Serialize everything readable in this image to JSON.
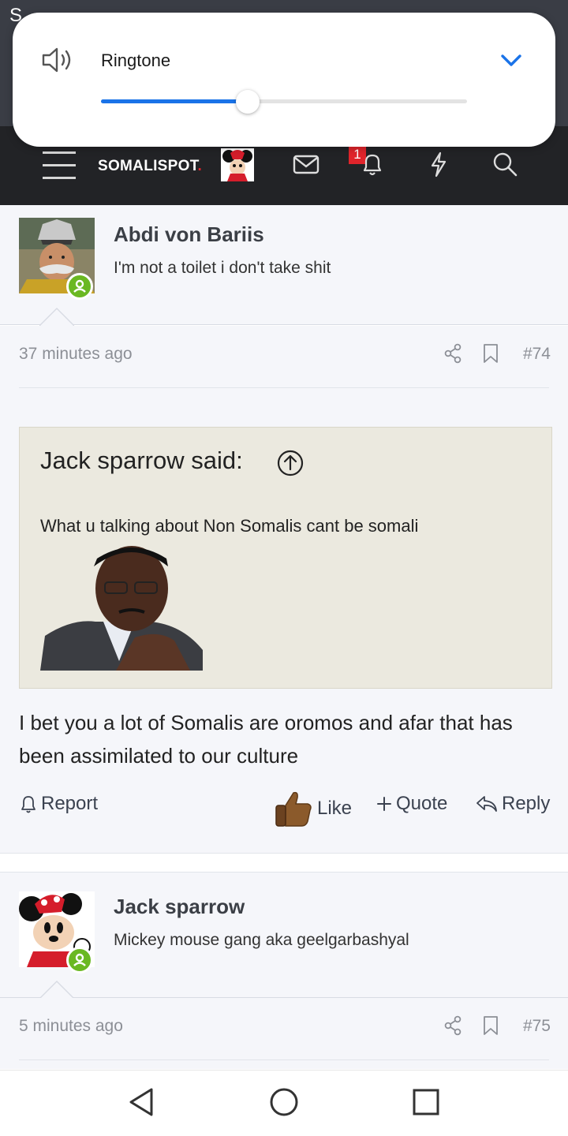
{
  "status_bar": {
    "left_text": "S",
    "right_text": ""
  },
  "volume_panel": {
    "title": "Ringtone",
    "level": 0.4
  },
  "nav": {
    "logo_text": "SOMALISPOT",
    "logo_dot": ".",
    "notification_count": "1"
  },
  "posts": [
    {
      "author": "Abdi von Bariis",
      "user_title": "I'm not a toilet i don't take shit",
      "time": "37 minutes ago",
      "number": "#74",
      "quote": {
        "author": "Jack sparrow said:",
        "text": "What u talking about Non Somalis cant be somali"
      },
      "body": "I bet you a lot of Somalis are oromos and afar that has been assimilated to our culture",
      "actions": {
        "report": "Report",
        "like": "Like",
        "quote": "Quote",
        "reply": "Reply"
      }
    },
    {
      "author": "Jack sparrow",
      "user_title": "Mickey mouse gang aka geelgarbashyal",
      "time": "5 minutes ago",
      "number": "#75"
    }
  ],
  "colors": {
    "accent": "#1a73e8",
    "nav_bg": "#222326",
    "online": "#6ab822",
    "badge": "#e0242b",
    "quote_bg": "#ebe9df"
  }
}
